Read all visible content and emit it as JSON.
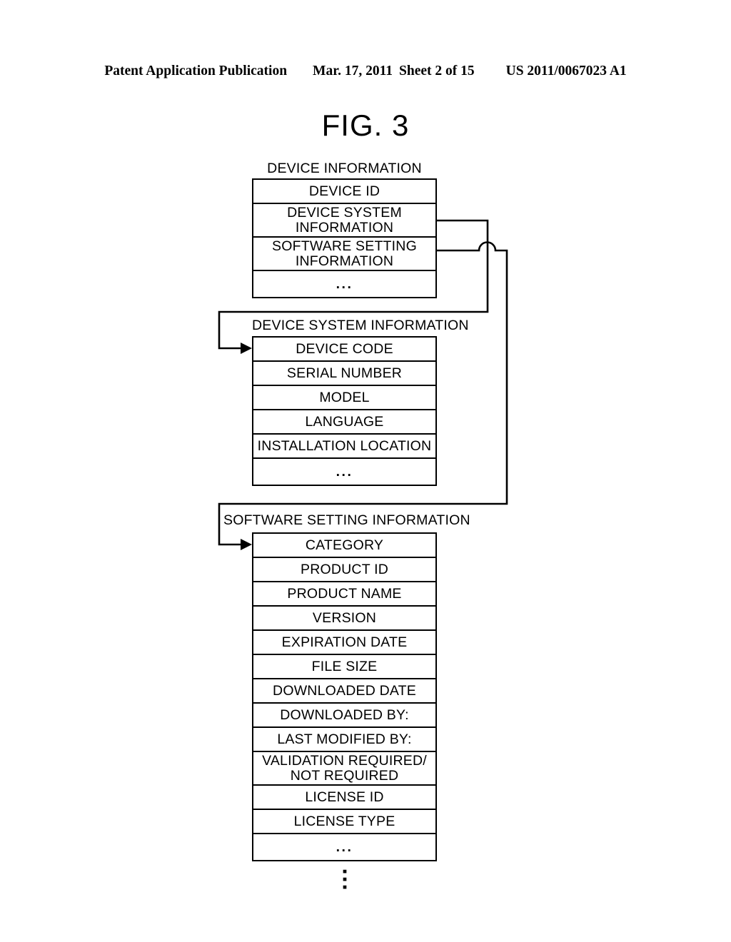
{
  "header": {
    "publication": "Patent Application Publication",
    "date": "Mar. 17, 2011",
    "sheet": "Sheet 2 of 15",
    "number": "US 2011/0067023 A1"
  },
  "figure": {
    "title": "FIG. 3"
  },
  "structures": [
    {
      "id": "device-information",
      "caption": "DEVICE INFORMATION",
      "rows": [
        {
          "label": "DEVICE ID",
          "lines": [
            "DEVICE ID"
          ]
        },
        {
          "label": "DEVICE SYSTEM INFORMATION",
          "lines": [
            "DEVICE SYSTEM",
            "INFORMATION"
          ]
        },
        {
          "label": "SOFTWARE SETTING INFORMATION",
          "lines": [
            "SOFTWARE SETTING",
            "INFORMATION"
          ]
        },
        {
          "label": "ellipsis",
          "lines": [
            "..."
          ]
        }
      ]
    },
    {
      "id": "device-system-information",
      "caption": "DEVICE SYSTEM INFORMATION",
      "rows": [
        {
          "label": "DEVICE CODE",
          "lines": [
            "DEVICE CODE"
          ]
        },
        {
          "label": "SERIAL NUMBER",
          "lines": [
            "SERIAL NUMBER"
          ]
        },
        {
          "label": "MODEL",
          "lines": [
            "MODEL"
          ]
        },
        {
          "label": "LANGUAGE",
          "lines": [
            "LANGUAGE"
          ]
        },
        {
          "label": "INSTALLATION LOCATION",
          "lines": [
            "INSTALLATION LOCATION"
          ]
        },
        {
          "label": "ellipsis",
          "lines": [
            "..."
          ]
        }
      ]
    },
    {
      "id": "software-setting-information",
      "caption": "SOFTWARE SETTING INFORMATION",
      "rows": [
        {
          "label": "CATEGORY",
          "lines": [
            "CATEGORY"
          ]
        },
        {
          "label": "PRODUCT ID",
          "lines": [
            "PRODUCT ID"
          ]
        },
        {
          "label": "PRODUCT NAME",
          "lines": [
            "PRODUCT NAME"
          ]
        },
        {
          "label": "VERSION",
          "lines": [
            "VERSION"
          ]
        },
        {
          "label": "EXPIRATION DATE",
          "lines": [
            "EXPIRATION DATE"
          ]
        },
        {
          "label": "FILE SIZE",
          "lines": [
            "FILE SIZE"
          ]
        },
        {
          "label": "DOWNLOADED DATE",
          "lines": [
            "DOWNLOADED DATE"
          ]
        },
        {
          "label": "DOWNLOADED BY:",
          "lines": [
            "DOWNLOADED BY:"
          ]
        },
        {
          "label": "LAST MODIFIED BY:",
          "lines": [
            "LAST MODIFIED BY:"
          ]
        },
        {
          "label": "VALIDATION REQUIRED/ NOT REQUIRED",
          "lines": [
            "VALIDATION REQUIRED/",
            "NOT REQUIRED"
          ]
        },
        {
          "label": "LICENSE ID",
          "lines": [
            "LICENSE ID"
          ]
        },
        {
          "label": "LICENSE TYPE",
          "lines": [
            "LICENSE TYPE"
          ]
        },
        {
          "label": "ellipsis",
          "lines": [
            "..."
          ]
        }
      ]
    }
  ],
  "continuation": {
    "symbol": "vertical-ellipsis",
    "dots": [
      "▪",
      "▪",
      "▪"
    ]
  },
  "colors": {
    "ink": "#000000",
    "paper": "#ffffff"
  }
}
